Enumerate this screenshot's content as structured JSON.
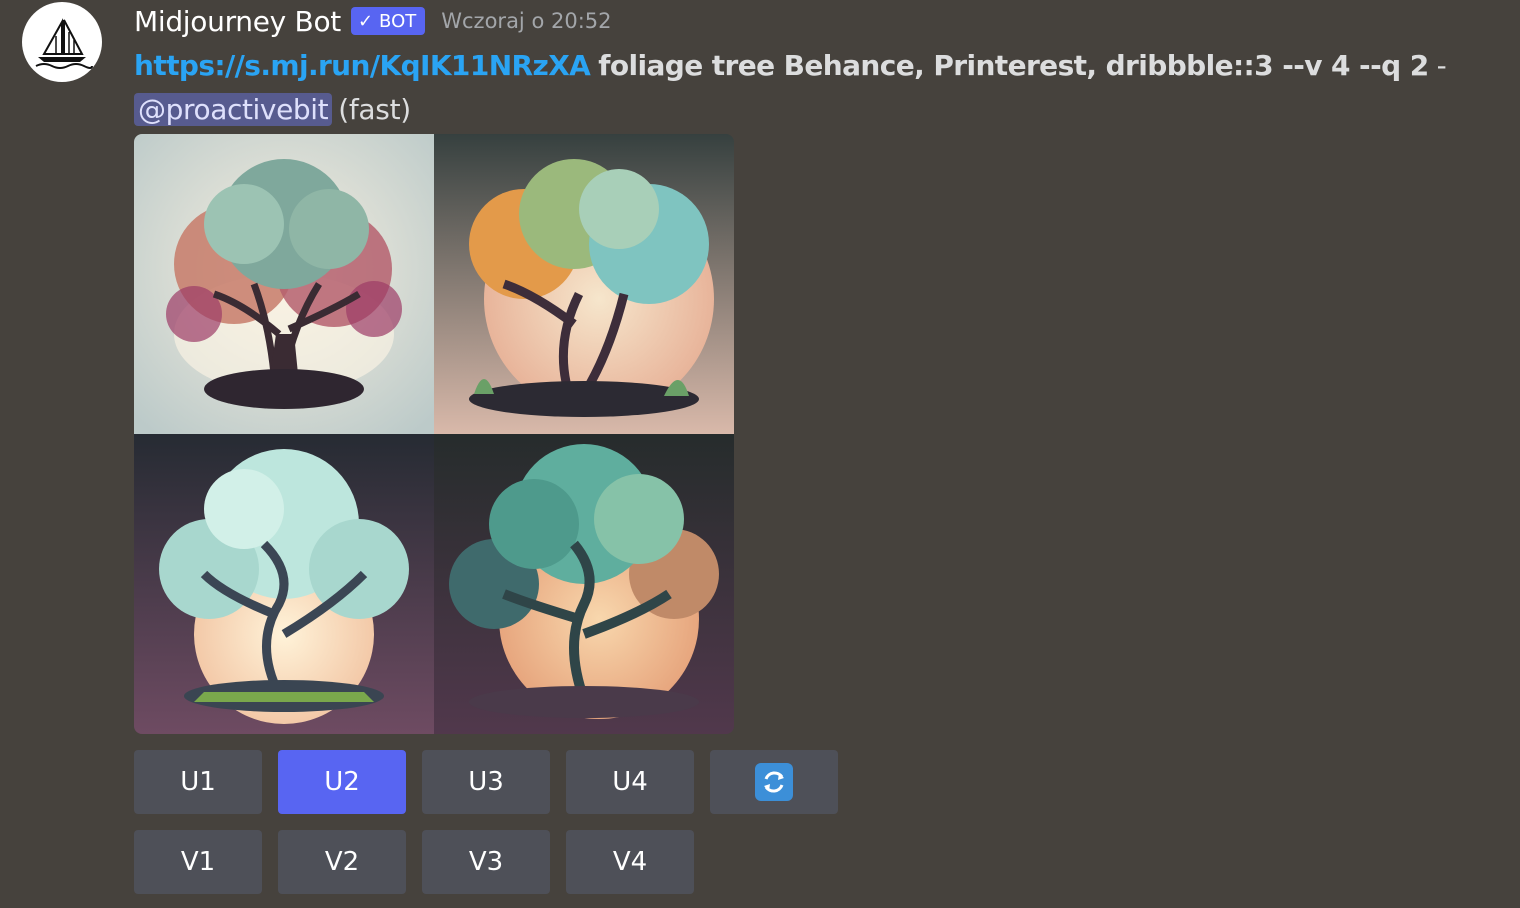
{
  "author": {
    "name": "Midjourney Bot",
    "badge": "BOT",
    "timestamp": "Wczoraj o 20:52",
    "avatar_icon": "sailboat-icon"
  },
  "message": {
    "link": "https://s.mj.run/KqIK11NRzXA",
    "prompt": "foliage tree Behance, Printerest, dribbble::3 --v 4 --q 2",
    "dash": "-",
    "mention": "@proactivebit",
    "speed": "(fast)"
  },
  "images": [
    {
      "name": "tree-image-1",
      "background": "#c8d0cf"
    },
    {
      "name": "tree-image-2",
      "background": "#3a4446"
    },
    {
      "name": "tree-image-3",
      "background": "#2c3138"
    },
    {
      "name": "tree-image-4",
      "background": "#2a3130"
    }
  ],
  "buttons": {
    "upscale": [
      "U1",
      "U2",
      "U3",
      "U4"
    ],
    "variation": [
      "V1",
      "V2",
      "V3",
      "V4"
    ],
    "active": "U2",
    "reroll_icon": "refresh-icon"
  },
  "colors": {
    "background": "#46423d",
    "link": "#2aa4f4",
    "accent": "#5865f2",
    "button": "#4e5058"
  }
}
